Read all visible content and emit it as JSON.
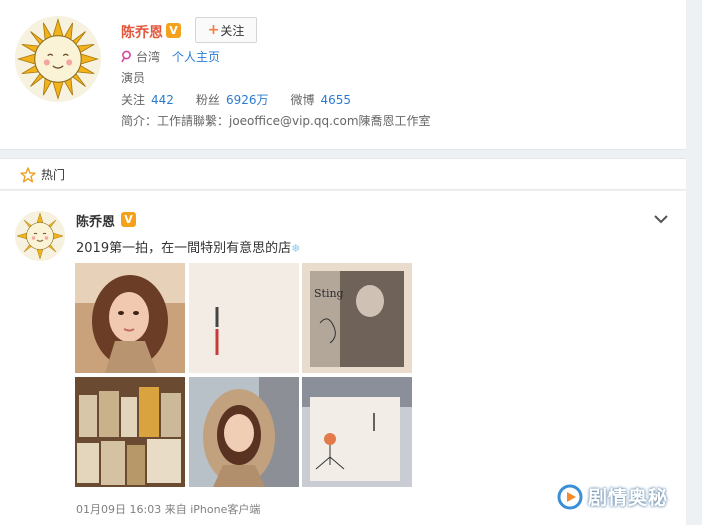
{
  "profile": {
    "name": "陈乔恩",
    "verified_badge": "V",
    "follow_label": "关注",
    "location": "台湾",
    "homepage_link": "个人主页",
    "occupation": "演员",
    "stats": [
      {
        "label": "关注",
        "value": "442"
      },
      {
        "label": "粉丝",
        "value": "6926万"
      },
      {
        "label": "微博",
        "value": "4655"
      }
    ],
    "bio": "简介：工作請聯繫：joeoffice@vip.qq.com陳喬恩工作室"
  },
  "hot_bar": {
    "label": "热门"
  },
  "post": {
    "author": "陈乔恩",
    "verified_badge": "V",
    "text": "2019第一拍，在一間特別有意思的店",
    "emoji": "❄",
    "time": "01月09日 16:03",
    "source_prefix": "来自",
    "source": "iPhone客户端",
    "images": [
      {
        "alt": "selfie-hood"
      },
      {
        "alt": "book-page"
      },
      {
        "alt": "sting-record"
      },
      {
        "alt": "bookshelf"
      },
      {
        "alt": "selfie-street"
      },
      {
        "alt": "book-cover-tree"
      }
    ]
  },
  "watermark": {
    "text": "剧情奥秘"
  },
  "colors": {
    "name_red": "#e2573c",
    "link_blue": "#2a7cd2",
    "badge_orange": "#f4a21c",
    "page_bg": "#eef1f4"
  },
  "icons": {
    "verified": "v-badge-icon",
    "location": "location-pin-icon",
    "hot": "star-outline-icon",
    "more": "chevron-down-icon",
    "watermark": "play-logo-icon"
  }
}
